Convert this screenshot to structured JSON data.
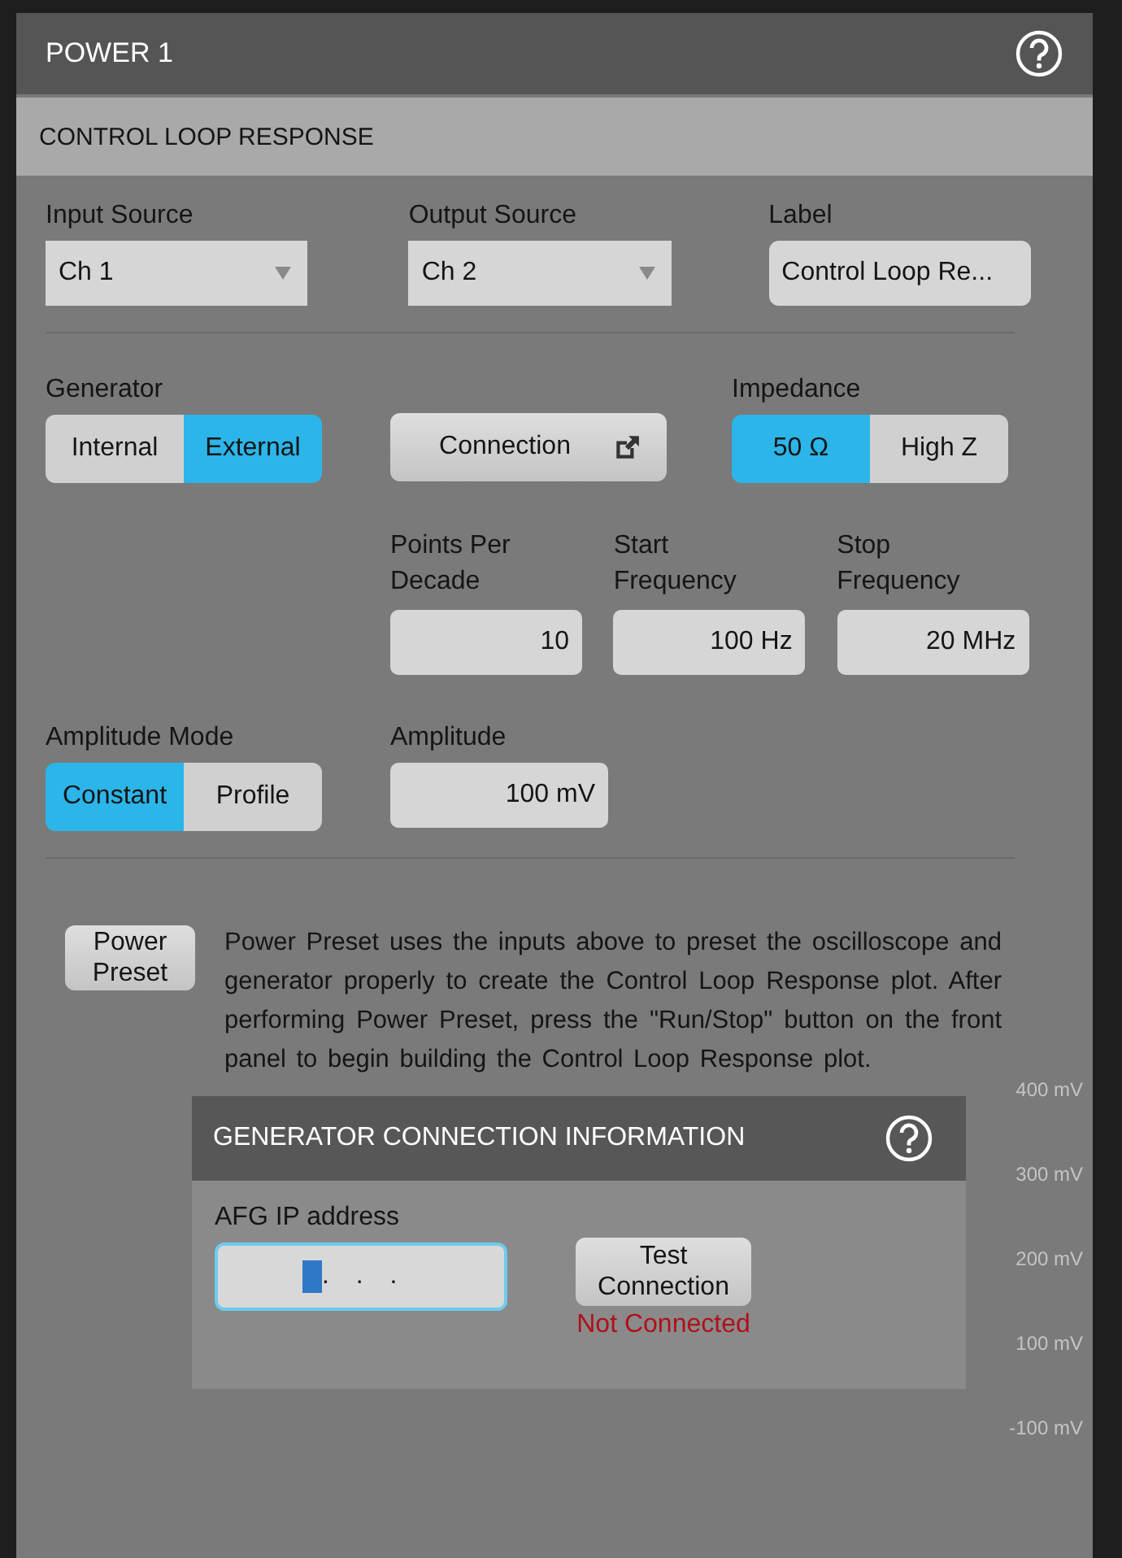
{
  "panel": {
    "title": "POWER 1"
  },
  "section": {
    "title": "CONTROL LOOP RESPONSE"
  },
  "sources": [
    {
      "label": "Input Source",
      "value": "Ch 1",
      "kind": "dropdown"
    },
    {
      "label": "Output Source",
      "value": "Ch 2",
      "kind": "dropdown"
    },
    {
      "label": "Label",
      "value": "Control Loop Re...",
      "kind": "text"
    }
  ],
  "generator": {
    "label": "Generator",
    "options": [
      {
        "label": "Internal",
        "selected": false
      },
      {
        "label": "External",
        "selected": true
      }
    ]
  },
  "connection_button": {
    "label": "Connection"
  },
  "impedance": {
    "label": "Impedance",
    "options": [
      {
        "label": "50 Ω",
        "selected": true
      },
      {
        "label": "High Z",
        "selected": false
      }
    ]
  },
  "sweep_fields": [
    {
      "label": "Points Per Decade",
      "value": "10"
    },
    {
      "label": "Start Frequency",
      "value": "100 Hz"
    },
    {
      "label": "Stop Frequency",
      "value": "20 MHz"
    }
  ],
  "amplitude_mode": {
    "label": "Amplitude Mode",
    "options": [
      {
        "label": "Constant",
        "selected": true
      },
      {
        "label": "Profile",
        "selected": false
      }
    ]
  },
  "amplitude": {
    "label": "Amplitude",
    "value": "100 mV"
  },
  "power_preset": {
    "label": "Power Preset",
    "description": "Power Preset uses the inputs above to preset the oscilloscope and generator properly to create the Control Loop Response plot. After performing Power Preset, press the \"Run/Stop\" button on the front panel to begin building the Control Loop Response plot."
  },
  "dialog": {
    "title": "GENERATOR CONNECTION INFORMATION",
    "ip_label": "AFG IP address",
    "ip_value": ". . .",
    "test_button": "Test Connection",
    "status": "Not Connected"
  },
  "background_axis_labels": [
    "400 mV",
    "300 mV",
    "200 mV",
    "100 mV",
    "-100 mV"
  ]
}
